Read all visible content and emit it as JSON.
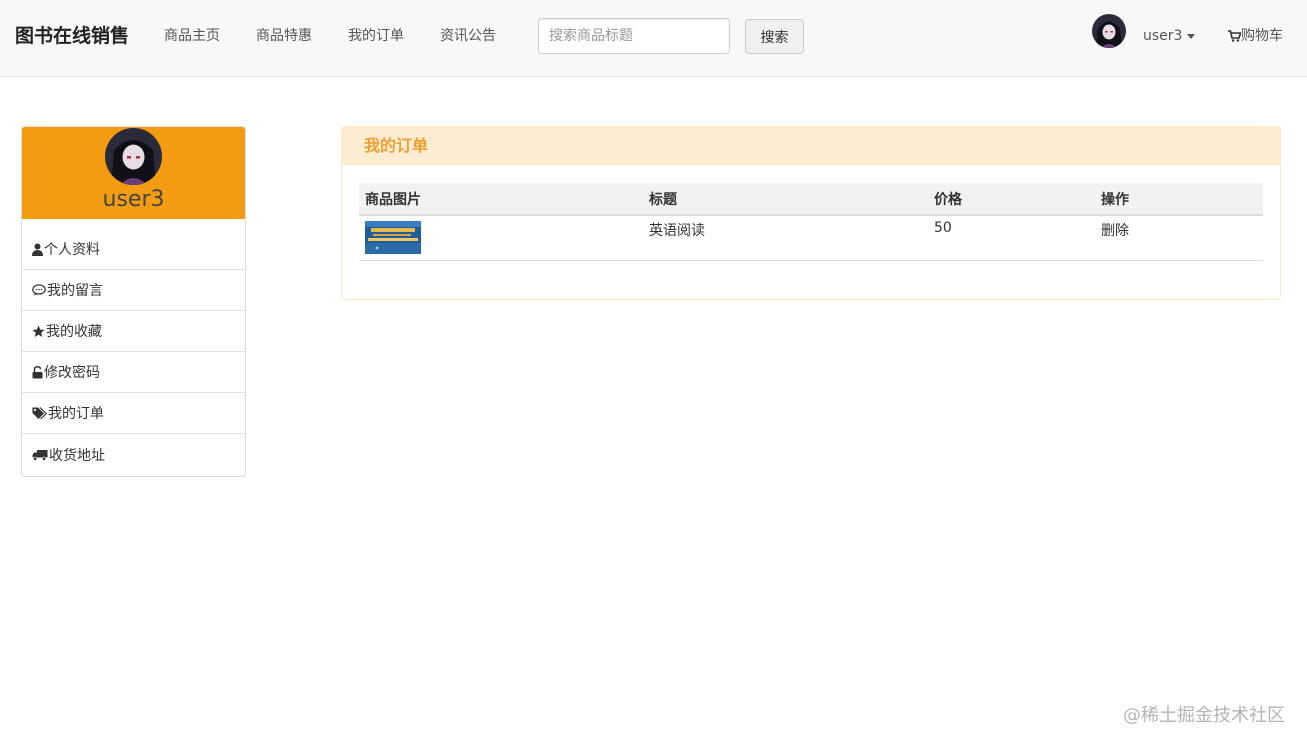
{
  "navbar": {
    "brand": "图书在线销售",
    "links": [
      "商品主页",
      "商品特惠",
      "我的订单",
      "资讯公告"
    ],
    "search": {
      "placeholder": "搜索商品标题",
      "value": "",
      "button_label": "搜索"
    },
    "user_label": "user3",
    "cart_label": "购物车"
  },
  "sidebar": {
    "username": "user3",
    "items": [
      {
        "label": "个人资料",
        "icon": "user-icon"
      },
      {
        "label": "我的留言",
        "icon": "comment-icon"
      },
      {
        "label": "我的收藏",
        "icon": "star-icon"
      },
      {
        "label": "修改密码",
        "icon": "unlock-icon"
      },
      {
        "label": "我的订单",
        "icon": "tags-icon"
      },
      {
        "label": "收货地址",
        "icon": "truck-icon"
      }
    ]
  },
  "panel": {
    "title": "我的订单",
    "columns": [
      "商品图片",
      "标题",
      "价格",
      "操作"
    ],
    "rows": [
      {
        "title": "英语阅读",
        "price": "50",
        "action": "删除"
      }
    ]
  },
  "watermark": "@稀土掘金技术社区",
  "colors": {
    "accent": "#f39c12",
    "panel_heading_bg": "#fcecd1",
    "panel_heading_text": "#f0a030",
    "navbar_bg": "#f8f8f8"
  }
}
